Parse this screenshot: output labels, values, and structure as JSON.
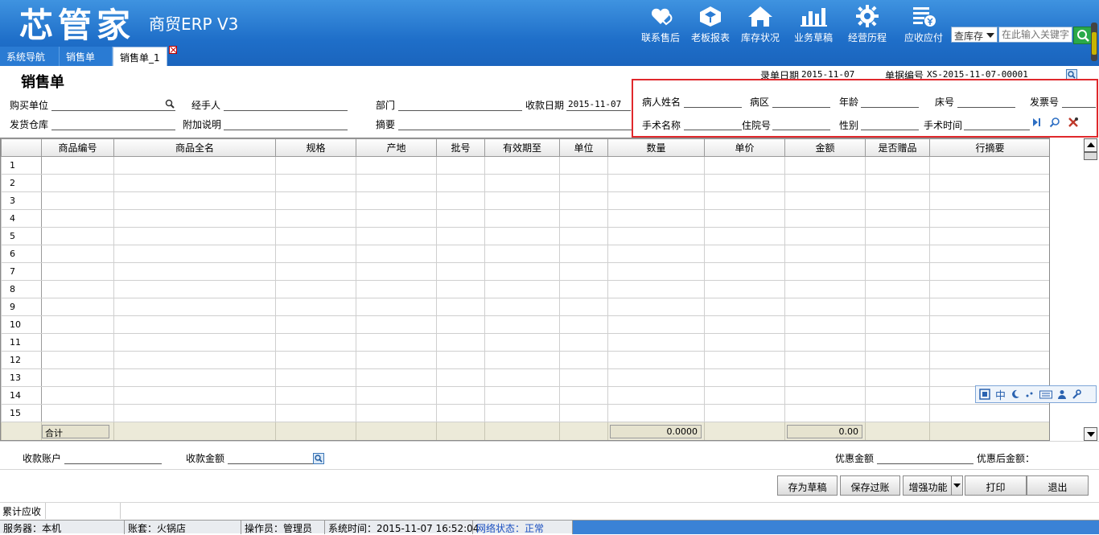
{
  "app": {
    "logo": "芯管家",
    "subtitle": "商贸ERP V3"
  },
  "topnav": [
    {
      "label": "联系售后",
      "icon": "heart-chat-icon"
    },
    {
      "label": "老板报表",
      "icon": "cube-icon"
    },
    {
      "label": "库存状况",
      "icon": "house-icon"
    },
    {
      "label": "业务草稿",
      "icon": "bar-chart-icon"
    },
    {
      "label": "经营历程",
      "icon": "gear-icon"
    },
    {
      "label": "应收应付",
      "icon": "list-money-icon"
    }
  ],
  "search": {
    "select_value": "查库存",
    "placeholder": "在此输入关键字"
  },
  "tabs": [
    "系统导航",
    "销售单",
    "销售单_1"
  ],
  "form": {
    "title": "销售单",
    "entry_date_label": "录单日期",
    "entry_date": "2015-11-07",
    "doc_no_label": "单据编号",
    "doc_no": "XS-2015-11-07-00001",
    "buyer_label": "购买单位",
    "handler_label": "经手人",
    "dept_label": "部门",
    "receipt_date_label": "收款日期",
    "receipt_date": "2015-11-07",
    "warehouse_label": "发货仓库",
    "note_label": "附加说明",
    "summary_label": "摘要",
    "patient_name_label": "病人姓名",
    "ward_label": "病区",
    "age_label": "年龄",
    "bed_label": "床号",
    "invoice_label": "发票号",
    "surgery_name_label": "手术名称",
    "admission_label": "住院号",
    "gender_label": "性别",
    "surgery_time_label": "手术时间"
  },
  "grid": {
    "columns": [
      "商品编号",
      "商品全名",
      "规格",
      "产地",
      "批号",
      "有效期至",
      "单位",
      "数量",
      "单价",
      "金额",
      "是否赠品",
      "行摘要"
    ],
    "rows": [
      "1",
      "2",
      "3",
      "4",
      "5",
      "6",
      "7",
      "8",
      "9",
      "10",
      "11",
      "12",
      "13",
      "14",
      "15"
    ],
    "total_label": "合计",
    "total_qty": "0.0000",
    "total_amount": "0.00"
  },
  "ime": {
    "mode": "中"
  },
  "footer": {
    "account_label": "收款账户",
    "amount_label": "收款金额",
    "discount_label": "优惠金额",
    "after_discount_label": "优惠后金额：",
    "buttons": {
      "draft": "存为草稿",
      "save": "保存过账",
      "enhance": "增强功能",
      "print": "打印",
      "exit": "退出"
    },
    "receivable_label": "累计应收"
  },
  "status": {
    "server": "服务器：本机",
    "account": "账套：火锅店",
    "operator": "操作员：管理员",
    "time": "系统时间：2015-11-07 16:52:04",
    "network": "网络状态：正常"
  },
  "colors": {
    "header": "#2b7fd6",
    "highlight": "#e0282c",
    "status_fill": "#3a82d6"
  }
}
